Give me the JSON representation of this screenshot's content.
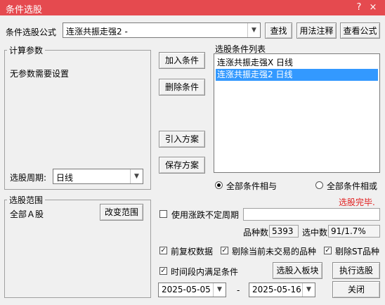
{
  "window": {
    "title": "条件选股",
    "close_glyph": "×"
  },
  "formula": {
    "label": "条件选股公式",
    "selected": "连涨共振走强2 -",
    "find_btn": "查找",
    "usage_btn": "用法注释",
    "view_btn": "查看公式"
  },
  "params": {
    "title": "计算参数",
    "message": "无参数需要设置",
    "period_label": "选股周期:",
    "period_value": "日线"
  },
  "actions": {
    "add": "加入条件",
    "remove": "删除条件",
    "import": "引入方案",
    "save": "保存方案"
  },
  "conditions": {
    "title": "选股条件列表",
    "items": [
      {
        "text": "连涨共振走强X  日线",
        "selected": false
      },
      {
        "text": "连涨共振走强2  日线",
        "selected": true
      }
    ]
  },
  "logic": {
    "all_and": "全部条件相与",
    "all_or": "全部条件相或",
    "selected": "and"
  },
  "status": {
    "text": "选股完毕.",
    "color": "#e02020"
  },
  "scope": {
    "title": "选股范围",
    "value": "全部Ａ股",
    "change_btn": "改变范围"
  },
  "options": {
    "uncertain_period": {
      "label": "使用涨跌不定周期",
      "checked": false,
      "value": ""
    },
    "stock_count_label": "品种数",
    "stock_count": "5393",
    "selected_label": "选中数",
    "selected_value": "91/1.7%",
    "forward_adjust": {
      "label": "前复权数据",
      "checked": true
    },
    "exclude_nontrading": {
      "label": "剔除当前未交易的品种",
      "checked": true
    },
    "exclude_st": {
      "label": "剔除ST品种",
      "checked": true
    },
    "in_period": {
      "label": "时间段内满足条件",
      "checked": true
    }
  },
  "date_range": {
    "start": "2025-05-05",
    "separator": "-",
    "end": "2025-05-16"
  },
  "bottom": {
    "to_block": "选股入板块",
    "execute": "执行选股",
    "close": "关闭"
  }
}
